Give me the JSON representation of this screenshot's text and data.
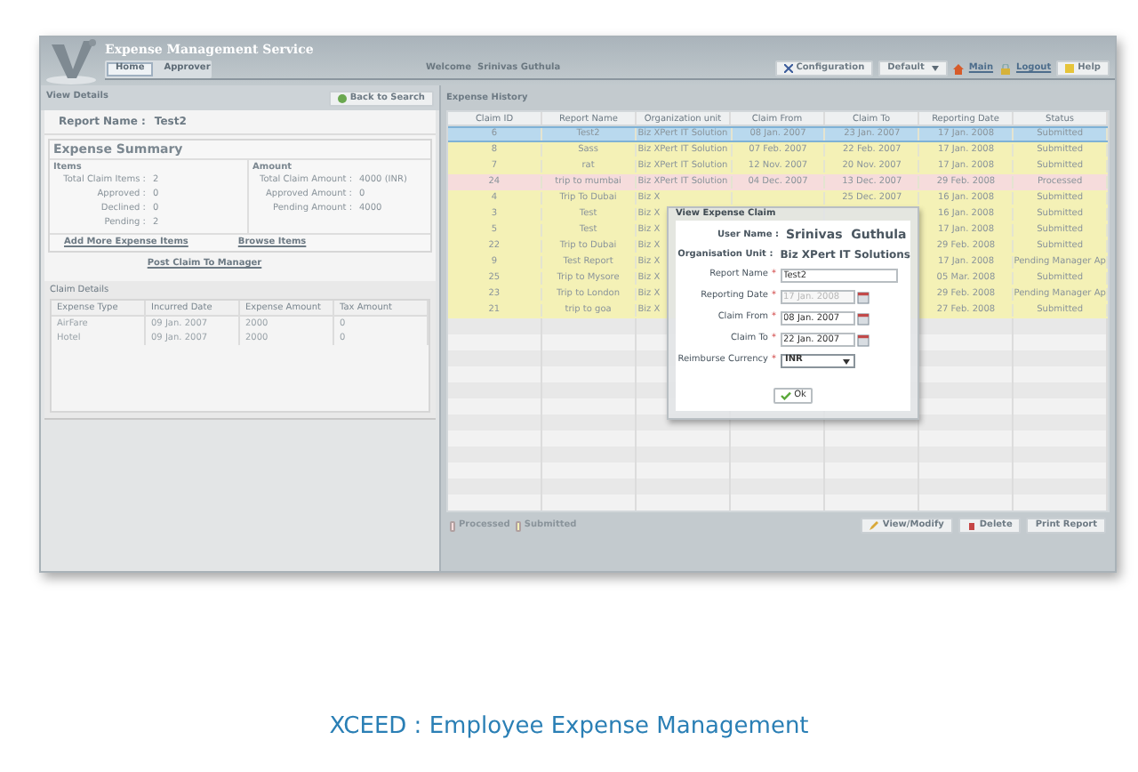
{
  "app": {
    "title": "Expense Management Service",
    "nav_tabs": [
      {
        "label": "Home",
        "selected": true
      },
      {
        "label": "Approver",
        "selected": false
      }
    ],
    "welcome": "Welcome  Srinivas Guthula",
    "configuration": "Configuration",
    "profile": "Default",
    "main_link": "Main",
    "logout_link": "Logout",
    "help": "Help"
  },
  "view_details": {
    "title": "View Details",
    "back_button": "Back to Search",
    "report_name_label": "Report Name :",
    "report_name": "Test2",
    "summary": {
      "title": "Expense Summary",
      "items_heading": "Items",
      "amount_heading": "Amount",
      "items": [
        {
          "label": "Total Claim Items :",
          "value": "2"
        },
        {
          "label": "Approved :",
          "value": "0"
        },
        {
          "label": "Declined :",
          "value": "0"
        },
        {
          "label": "Pending :",
          "value": "2"
        }
      ],
      "amounts": [
        {
          "label": "Total Claim Amount :",
          "value": "4000 (INR)"
        },
        {
          "label": "Approved Amount :",
          "value": "0"
        },
        {
          "label": "Pending Amount :",
          "value": "4000"
        }
      ],
      "links": [
        "Add More Expense Items",
        "Browse Items"
      ]
    },
    "post_link": "Post Claim To Manager",
    "claim_details": {
      "title": "Claim Details",
      "columns": [
        "Expense Type",
        "Incurred Date",
        "Expense Amount",
        "Tax Amount"
      ],
      "rows": [
        [
          "AirFare",
          "09 Jan. 2007",
          "2000",
          "0"
        ],
        [
          "Hotel",
          "09 Jan. 2007",
          "2000",
          "0"
        ]
      ]
    }
  },
  "expense_history": {
    "title": "Expense History",
    "columns": [
      "Claim ID",
      "Report Name",
      "Organization unit",
      "Claim From",
      "Claim To",
      "Reporting Date",
      "Status"
    ],
    "rows": [
      {
        "claim_id": "6",
        "report_name": "Test2",
        "org_unit": "Biz XPert IT Solution",
        "claim_from": "08 Jan. 2007",
        "claim_to": "23 Jan. 2007",
        "reporting_date": "17 Jan. 2008",
        "status": "Submitted",
        "selected": true,
        "color": "#b9d9ee"
      },
      {
        "claim_id": "8",
        "report_name": "Sass",
        "org_unit": "Biz XPert IT Solution",
        "claim_from": "07 Feb. 2007",
        "claim_to": "22 Feb. 2007",
        "reporting_date": "17 Jan. 2008",
        "status": "Submitted",
        "selected": false,
        "color": "#f4f1b6"
      },
      {
        "claim_id": "7",
        "report_name": "rat",
        "org_unit": "Biz XPert IT Solution",
        "claim_from": "12 Nov. 2007",
        "claim_to": "20 Nov. 2007",
        "reporting_date": "17 Jan. 2008",
        "status": "Submitted",
        "selected": false,
        "color": "#f4f1b6"
      },
      {
        "claim_id": "24",
        "report_name": "trip to mumbai",
        "org_unit": "Biz XPert IT Solution",
        "claim_from": "04 Dec. 2007",
        "claim_to": "13 Dec. 2007",
        "reporting_date": "29 Feb. 2008",
        "status": "Processed",
        "selected": false,
        "color": "#f6dcdc"
      },
      {
        "claim_id": "4",
        "report_name": "Trip To Dubai",
        "org_unit": "Biz X",
        "claim_to": "25 Dec. 2007",
        "reporting_date": "16 Jan. 2008",
        "status": "Submitted",
        "selected": false,
        "color": "#f4f1b6"
      },
      {
        "claim_id": "3",
        "report_name": "Test",
        "org_unit": "Biz X",
        "reporting_date": "16 Jan. 2008",
        "status": "Submitted",
        "selected": false,
        "color": "#f4f1b6"
      },
      {
        "claim_id": "5",
        "report_name": "Test",
        "org_unit": "Biz X",
        "reporting_date": "17 Jan. 2008",
        "status": "Submitted",
        "selected": false,
        "color": "#f4f1b6"
      },
      {
        "claim_id": "22",
        "report_name": "Trip to Dubai",
        "org_unit": "Biz X",
        "reporting_date": "29 Feb. 2008",
        "status": "Submitted",
        "selected": false,
        "color": "#f4f1b6"
      },
      {
        "claim_id": "9",
        "report_name": "Test Report",
        "org_unit": "Biz X",
        "reporting_date": "17 Jan. 2008",
        "status": "Pending Manager Ap",
        "selected": false,
        "color": "#f4f1b6"
      },
      {
        "claim_id": "25",
        "report_name": "Trip to Mysore",
        "org_unit": "Biz X",
        "reporting_date": "05 Mar. 2008",
        "status": "Submitted",
        "selected": false,
        "color": "#f4f1b6"
      },
      {
        "claim_id": "23",
        "report_name": "Trip to London",
        "org_unit": "Biz X",
        "reporting_date": "29 Feb. 2008",
        "status": "Pending Manager Ap",
        "selected": false,
        "color": "#f4f1b6"
      },
      {
        "claim_id": "21",
        "report_name": "trip to goa",
        "org_unit": "Biz X",
        "reporting_date": "27 Feb. 2008",
        "status": "Submitted",
        "selected": false,
        "color": "#f4f1b6"
      }
    ],
    "legend": [
      {
        "label": "Processed",
        "color": "#f6dcdc"
      },
      {
        "label": "Submitted",
        "color": "#f4f1b6"
      }
    ],
    "buttons": [
      "View/Modify",
      "Delete",
      "Print Report"
    ]
  },
  "dialog": {
    "title": "View Expense Claim",
    "user_label": "User Name :",
    "user": "Srinivas  Guthula",
    "org_label": "Organisation Unit :",
    "org": "Biz XPert IT Solutions",
    "fields": [
      {
        "kind": "text",
        "label": "Report Name",
        "mark": "*",
        "value": "Test2",
        "disabled": false
      },
      {
        "kind": "date",
        "label": "Reporting Date",
        "mark": "*",
        "value": "17 Jan. 2008",
        "disabled": true
      },
      {
        "kind": "date",
        "label": "Claim From",
        "mark": "*",
        "value": "08 Jan. 2007",
        "disabled": false
      },
      {
        "kind": "date",
        "label": "Claim To",
        "mark": "*",
        "value": "22 Jan. 2007",
        "disabled": false
      },
      {
        "kind": "select",
        "label": "Reimburse Currency",
        "mark": "*",
        "value": "INR",
        "disabled": false
      }
    ],
    "ok": "Ok"
  },
  "caption": "XCEED : Employee Expense Management"
}
